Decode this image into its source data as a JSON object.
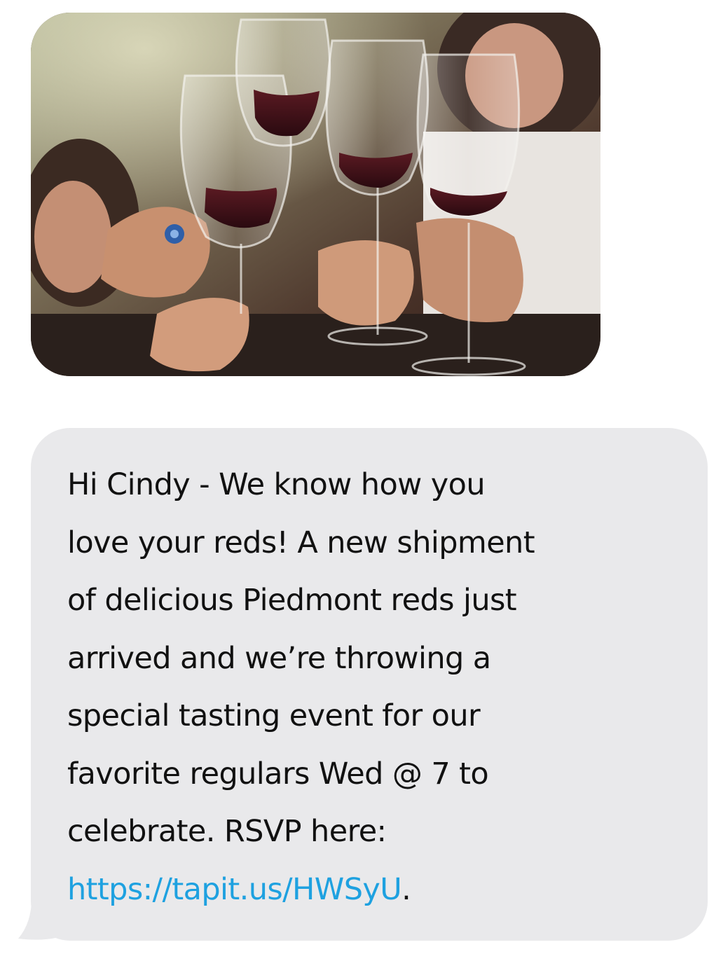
{
  "photo": {
    "description_icon": "wine-toast-photo"
  },
  "message": {
    "lines": [
      "Hi Cindy - We know how you",
      "love your reds! A new shipment",
      "of delicious Piedmont reds just",
      "arrived and we’re throwing a",
      "special tasting event for our",
      "favorite regulars Wed @ 7 to",
      "celebrate. RSVP here:"
    ],
    "link_text": "https://tapit.us/HWSyU",
    "link_trailing": "."
  },
  "colors": {
    "bubble_background": "#e9e9eb",
    "link": "#1ea1e0",
    "text": "#111111"
  }
}
